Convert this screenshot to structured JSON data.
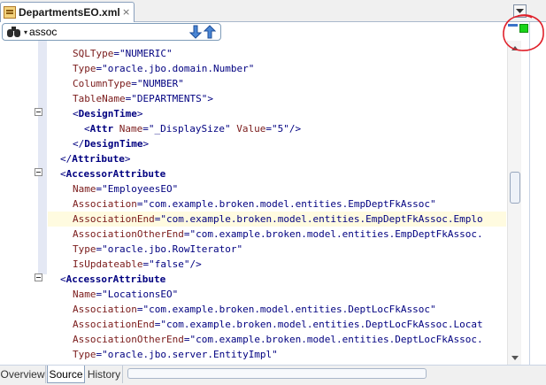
{
  "tab": {
    "title": "DepartmentsEO.xml",
    "close": "×"
  },
  "search": {
    "value": "assoc"
  },
  "code_lines": [
    [
      [
        "attr",
        "SQLType"
      ],
      [
        "punc",
        "="
      ],
      [
        "val",
        "\"NUMERIC\""
      ]
    ],
    [
      [
        "attr",
        "Type"
      ],
      [
        "punc",
        "="
      ],
      [
        "val",
        "\"oracle.jbo.domain.Number\""
      ]
    ],
    [
      [
        "attr",
        "ColumnType"
      ],
      [
        "punc",
        "="
      ],
      [
        "val",
        "\"NUMBER\""
      ]
    ],
    [
      [
        "attr",
        "TableName"
      ],
      [
        "punc",
        "="
      ],
      [
        "val",
        "\"DEPARTMENTS\""
      ],
      [
        "punc",
        ">"
      ]
    ],
    [
      [
        "punc",
        "<"
      ],
      [
        "tag",
        "DesignTime"
      ],
      [
        "punc",
        ">"
      ]
    ],
    [
      [
        "punc",
        "<"
      ],
      [
        "tag",
        "Attr"
      ],
      [
        "punc",
        " "
      ],
      [
        "attr",
        "Name"
      ],
      [
        "punc",
        "="
      ],
      [
        "val",
        "\"_DisplaySize\""
      ],
      [
        "punc",
        " "
      ],
      [
        "attr",
        "Value"
      ],
      [
        "punc",
        "="
      ],
      [
        "val",
        "\"5\""
      ],
      [
        "punc",
        "/>"
      ]
    ],
    [
      [
        "punc",
        "</"
      ],
      [
        "tag",
        "DesignTime"
      ],
      [
        "punc",
        ">"
      ]
    ],
    [
      [
        "punc",
        "</"
      ],
      [
        "tag",
        "Attribute"
      ],
      [
        "punc",
        ">"
      ]
    ],
    [
      [
        "punc",
        "<"
      ],
      [
        "tag",
        "AccessorAttribute"
      ]
    ],
    [
      [
        "attr",
        "Name"
      ],
      [
        "punc",
        "="
      ],
      [
        "val",
        "\"EmployeesEO\""
      ]
    ],
    [
      [
        "attr",
        "Association"
      ],
      [
        "punc",
        "="
      ],
      [
        "val",
        "\"com.example.broken.model.entities.EmpDeptFkAssoc\""
      ]
    ],
    [
      [
        "attr",
        "AssociationEnd"
      ],
      [
        "punc",
        "="
      ],
      [
        "val",
        "\"com.example.broken.model.entities.EmpDeptFkAssoc.Emplo"
      ]
    ],
    [
      [
        "attr",
        "AssociationOtherEnd"
      ],
      [
        "punc",
        "="
      ],
      [
        "val",
        "\"com.example.broken.model.entities.EmpDeptFkAssoc."
      ]
    ],
    [
      [
        "attr",
        "Type"
      ],
      [
        "punc",
        "="
      ],
      [
        "val",
        "\"oracle.jbo.RowIterator\""
      ]
    ],
    [
      [
        "attr",
        "IsUpdateable"
      ],
      [
        "punc",
        "="
      ],
      [
        "val",
        "\"false\""
      ],
      [
        "punc",
        "/>"
      ]
    ],
    [
      [
        "punc",
        "<"
      ],
      [
        "tag",
        "AccessorAttribute"
      ]
    ],
    [
      [
        "attr",
        "Name"
      ],
      [
        "punc",
        "="
      ],
      [
        "val",
        "\"LocationsEO\""
      ]
    ],
    [
      [
        "attr",
        "Association"
      ],
      [
        "punc",
        "="
      ],
      [
        "val",
        "\"com.example.broken.model.entities.DeptLocFkAssoc\""
      ]
    ],
    [
      [
        "attr",
        "AssociationEnd"
      ],
      [
        "punc",
        "="
      ],
      [
        "val",
        "\"com.example.broken.model.entities.DeptLocFkAssoc.Locat"
      ]
    ],
    [
      [
        "attr",
        "AssociationOtherEnd"
      ],
      [
        "punc",
        "="
      ],
      [
        "val",
        "\"com.example.broken.model.entities.DeptLocFkAssoc."
      ]
    ],
    [
      [
        "attr",
        "Type"
      ],
      [
        "punc",
        "="
      ],
      [
        "val",
        "\"oracle.jbo.server.EntityImpl\""
      ]
    ]
  ],
  "bottom_tabs": [
    {
      "label": "Overview",
      "active": false
    },
    {
      "label": "Source",
      "active": true
    },
    {
      "label": "History",
      "active": false
    }
  ],
  "colors": {
    "status_indicator": "#19d419",
    "annotation_circle": "#e0202a",
    "current_line_highlight": "#fffbe0"
  },
  "icons": {
    "file_tab": "xml-file-icon",
    "search": "binoculars-icon",
    "find_next": "arrow-down-icon",
    "find_previous": "arrow-up-icon"
  }
}
